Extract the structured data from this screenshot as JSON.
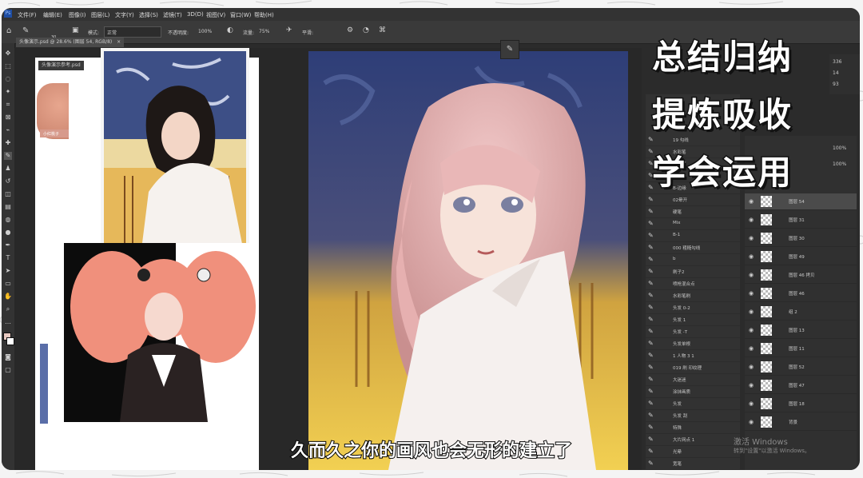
{
  "menu": [
    "文件(F)",
    "编辑(E)",
    "图像(I)",
    "图层(L)",
    "文字(Y)",
    "选择(S)",
    "滤镜(T)",
    "3D(D)",
    "视图(V)",
    "窗口(W)",
    "帮助(H)"
  ],
  "options": {
    "brush_size": "30",
    "mode_label": "模式:",
    "mode_value": "正常",
    "opacity_label": "不透明度:",
    "opacity_value": "100%",
    "flow_label": "流量:",
    "flow_value": "75%",
    "smoothing_label": "平滑:"
  },
  "tabs": [
    {
      "label": "头像演示.psd @ 28.6% (图层 54, RGB/8)"
    },
    {
      "label": "头像演示参考.psd"
    }
  ],
  "reference_labels": {
    "small_tag": "小红桃子"
  },
  "brush_panel": {
    "items": [
      "19 勾线",
      "水彩笔",
      "均头笔",
      "铅笔",
      "B-边缘",
      "02晕开",
      "硬笔",
      "Mix",
      "B-1",
      "000 粗糙勾线",
      "b",
      "刷子2",
      "喷枪混合点",
      "水彩笔刷",
      "头发 0-2",
      "头发 1",
      "头发 -T",
      "头发单根",
      "1 人物 3 1",
      "019 刷 印纹理",
      "大迷迷",
      "涂抹画质",
      "头发",
      "头发 刮",
      "特殊",
      "大片网点 1",
      "光晕",
      "宽笔"
    ]
  },
  "layers_panel": {
    "opacity": "100%",
    "fill": "100%",
    "items": [
      {
        "name": "图层 54"
      },
      {
        "name": "图层 31"
      },
      {
        "name": "图层 30"
      },
      {
        "name": "图层 49"
      },
      {
        "name": "图层 46 拷贝"
      },
      {
        "name": "图层 46"
      },
      {
        "name": "组 2"
      },
      {
        "name": "图层 13"
      },
      {
        "name": "图层 11"
      },
      {
        "name": "图层 52"
      },
      {
        "name": "图层 47"
      },
      {
        "name": "图层 18"
      },
      {
        "name": "背景"
      }
    ]
  },
  "color_panel": {
    "v1": "336",
    "v2": "14",
    "v3": "93"
  },
  "overlay_title": [
    "总结归纳",
    "提炼吸收",
    "学会运用"
  ],
  "subtitle": "久而久之你的画风也会无形的建立了",
  "watermark": {
    "line1": "激活 Windows",
    "line2": "转到\"设置\"以激活 Windows。"
  },
  "colors": {
    "ps_dark": "#2b2b2b",
    "panel": "#323232",
    "accent_blue": "#2c4aa0"
  }
}
